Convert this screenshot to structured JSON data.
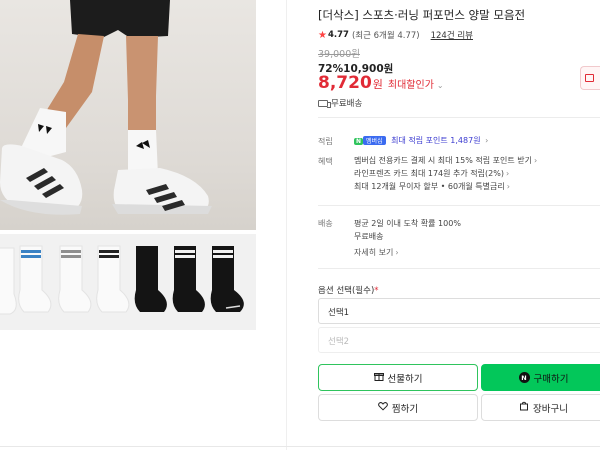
{
  "product": {
    "title": "[더삭스] 스포츠·러닝 퍼포먼스 양말 모음전",
    "rating": "4.77",
    "rating_detail": "(최근 6개월 4.77)",
    "review_count": "124건 리뷰",
    "original_price": "39,000원",
    "discount_line": "72%10,900원",
    "sale_price": "8,720",
    "sale_unit": "원",
    "max_discount_label": "최대할인가",
    "shipping": "무료배송"
  },
  "benefits": {
    "point_label": "적립",
    "badge_n": "N",
    "badge_plus": "멤버십",
    "point_text": "최대 적립 포인트 1,487원",
    "benefit_label": "혜택",
    "benefit_lines": [
      "멤버십 전용카드 결제 시 최대 15% 적립 포인트 받기",
      "라인프렌즈 카드 최대 174원 추가 적립(2%)",
      "최대 12개월 무이자 할부 • 60개월 특별금리"
    ],
    "delivery_label": "배송",
    "delivery_lines": [
      "평균 2일 이내 도착 확률 100%",
      "무료배송"
    ],
    "detail_link": "자세히 보기"
  },
  "options": {
    "label": "옵션 선택",
    "required": "(필수)",
    "select1": "선택1",
    "select2": "선택2"
  },
  "buttons": {
    "gift": "선물하기",
    "buy": "구매하기",
    "wish": "찜하기",
    "cart": "장바구니",
    "buy_badge": "N"
  },
  "icons": {
    "star": "star-icon",
    "truck": "truck-icon",
    "gift": "gift-icon",
    "heart": "heart-icon",
    "cart": "cart-icon"
  },
  "colors": {
    "sale_red": "#e12b36",
    "naver_green": "#03c75a",
    "point_blue": "#3b3bd0"
  }
}
